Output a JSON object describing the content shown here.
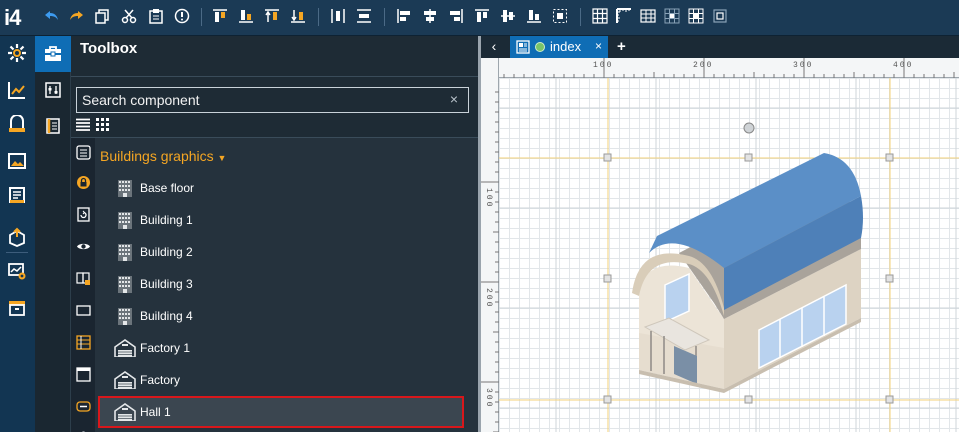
{
  "app": {
    "logo": "i4"
  },
  "toolbox": {
    "title": "Toolbox",
    "search_placeholder": "Search component",
    "clear_label": "×",
    "group_label": "Buildings graphics",
    "items": [
      {
        "label": "Base floor",
        "icon": "building-icon",
        "selected": false
      },
      {
        "label": "Building 1",
        "icon": "building-icon",
        "selected": false
      },
      {
        "label": "Building 2",
        "icon": "building-icon",
        "selected": false
      },
      {
        "label": "Building 3",
        "icon": "building-icon",
        "selected": false
      },
      {
        "label": "Building 4",
        "icon": "building-icon",
        "selected": false
      },
      {
        "label": "Factory 1",
        "icon": "factory-icon",
        "selected": false
      },
      {
        "label": "Factory",
        "icon": "factory-icon",
        "selected": false
      },
      {
        "label": "Hall 1",
        "icon": "factory-icon",
        "selected": true
      }
    ]
  },
  "editor": {
    "tab_label": "index",
    "tab_close": "×",
    "tab_add": "+",
    "back": "‹",
    "ruler_top": [
      "100",
      "200",
      "300",
      "400"
    ],
    "ruler_left": [
      "100",
      "200",
      "300"
    ]
  },
  "colors": {
    "accent": "#0f6db5",
    "group_label": "#f5a623",
    "selection_border": "#d8171b",
    "roof": "#5b8fc7",
    "wall": "#e6ddcf",
    "guide": "#f3d27a"
  }
}
